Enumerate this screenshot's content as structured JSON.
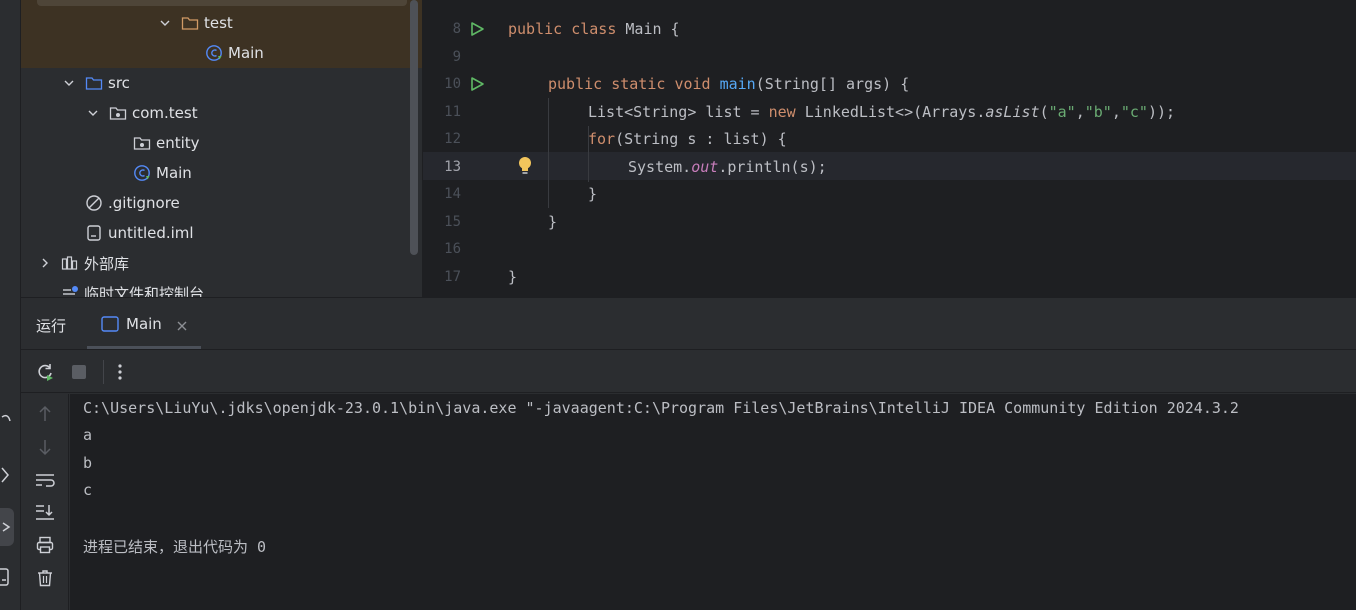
{
  "project_tree": {
    "items": [
      {
        "label": "test",
        "type": "folder",
        "expanded": true
      },
      {
        "label": "Main",
        "type": "java-class"
      },
      {
        "label": "src",
        "type": "source-folder",
        "expanded": true
      },
      {
        "label": "com.test",
        "type": "package",
        "expanded": true
      },
      {
        "label": "entity",
        "type": "package"
      },
      {
        "label": "Main",
        "type": "java-class"
      },
      {
        "label": ".gitignore",
        "type": "ignore-file"
      },
      {
        "label": "untitled.iml",
        "type": "iml-file"
      },
      {
        "label": "外部库",
        "type": "libraries",
        "expanded": false
      },
      {
        "label": "临时文件和控制台",
        "type": "scratches"
      }
    ]
  },
  "editor": {
    "current_line": 13,
    "lines": [
      {
        "num": "8"
      },
      {
        "num": "9"
      },
      {
        "num": "10"
      },
      {
        "num": "11"
      },
      {
        "num": "12"
      },
      {
        "num": "13"
      },
      {
        "num": "14"
      },
      {
        "num": "15"
      },
      {
        "num": "16"
      },
      {
        "num": "17"
      }
    ],
    "tokens": {
      "l8_public": "public",
      "l8_class": "class",
      "l8_rest": " Main {",
      "l10_public": "public",
      "l10_static": "static",
      "l10_void": "void",
      "l10_main": "main",
      "l10_rest": "(String[] args) {",
      "l11_a": "List<String> list = ",
      "l11_new": "new",
      "l11_b": " LinkedList<>(Arrays.",
      "l11_aslist": "asList",
      "l11_c": "(",
      "l11_sa": "\"a\"",
      "l11_comma1": ",",
      "l11_sb": "\"b\"",
      "l11_comma2": ",",
      "l11_sc": "\"c\"",
      "l11_d": "));",
      "l12_for": "for",
      "l12_rest": "(String s : list) {",
      "l13_a": "System.",
      "l13_out": "out",
      "l13_b": ".println(s);",
      "l14": "}",
      "l15": "}",
      "l17": "}"
    }
  },
  "run_panel": {
    "title": "运行",
    "tab_label": "Main",
    "console_lines": [
      "C:\\Users\\LiuYu\\.jdks\\openjdk-23.0.1\\bin\\java.exe \"-javaagent:C:\\Program Files\\JetBrains\\IntelliJ IDEA Community Edition 2024.3.2",
      "a",
      "b",
      "c",
      "",
      "进程已结束，退出代码为 0"
    ]
  },
  "colors": {
    "panel_bg": "#2b2d30",
    "editor_bg": "#1e1f22",
    "keyword": "#cf8e6d",
    "function": "#56a8f5",
    "string": "#6aab73",
    "static_field": "#c77dbb",
    "run_green": "#5fb865",
    "folder_orange": "#d19a66",
    "package_blue": "#548af7"
  }
}
